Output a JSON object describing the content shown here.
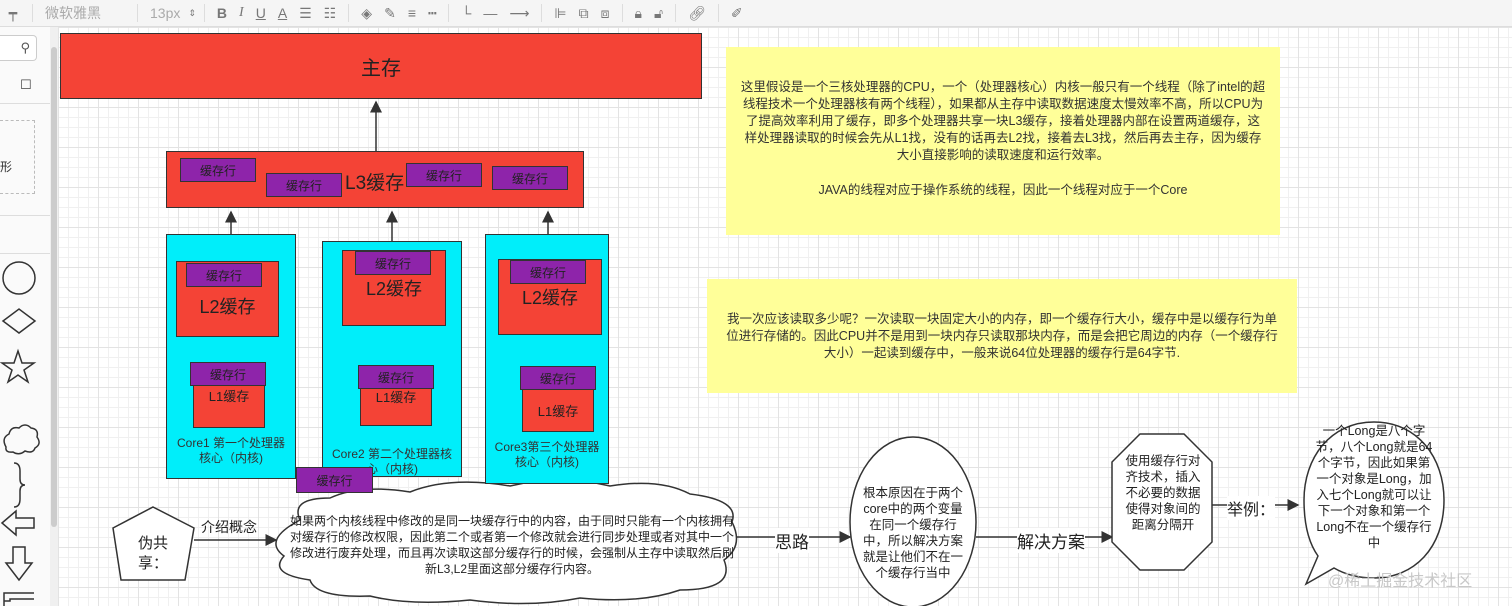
{
  "toolbar": {
    "font_name": "微软雅黑",
    "font_size": "13px",
    "bold": "B",
    "italic": "I",
    "underline": "U",
    "font_color": "A"
  },
  "diagram": {
    "main_memory": "主存",
    "l3_cache": "L3缓存",
    "cache_line": "缓存行",
    "l2_cache": "L2缓存",
    "l1_cache": "L1缓存",
    "core1_label": "Core1 第一个处理器核心（内核)",
    "core2_label": "Core2 第二个处理器核心（内核)",
    "core3_label": "Core3第三个处理器核心（内核)",
    "note1_p1": "这里假设是一个三核处理器的CPU，一个（处理器核心）内核一般只有一个线程（除了intel的超线程技术一个处理器核有两个线程），如果都从主存中读取数据速度太慢效率不高，所以CPU为了提高效率利用了缓存，即多个处理器共享一块L3缓存，接着处理器内部在设置两道缓存，这样处理器读取的时候会先从L1找，没有的话再去L2找，接着去L3找，然后再去主存，因为缓存大小直接影响的读取速度和运行效率。",
    "note1_p2": "JAVA的线程对应于操作系统的线程，因此一个线程对应于一个Core",
    "note2": "我一次应该读取多少呢？一次读取一块固定大小的内存，即一个缓存行大小，缓存中是以缓存行为单位进行存储的。因此CPU并不是用到一块内存只读取那块内存，而是会把它周边的内存（一个缓存行大小）一起读到缓存中，一般来说64位处理器的缓存行是64字节.",
    "false_sharing": "伪共享：",
    "intro_label": "介绍概念",
    "cloud_text": "如果两个内核线程中修改的是同一块缓存行中的内容，由于同时只能有一个内核拥有对缓存行的修改权限，因此第二个或者第一个修改就会进行同步处理或者对其中一个修改进行废弃处理，而且再次读取这部分缓存行的时候，会强制从主存中读取然后刷新L3,L2里面这部分缓存行内容。",
    "idea_label": "思路",
    "ellipse_text": "根本原因在于两个core中的两个变量在同一个缓存行中，所以解决方案就是让他们不在一个缓存行当中",
    "solution_label": "解决方案",
    "octagon_text": "使用缓存行对齐技术，插入不必要的数据使得对象间的距离分隔开",
    "example_label": "举例：",
    "bubble_text": "一个Long是八个字节，八个Long就是64个字节，因此如果第一个对象是Long，加入七个Long就可以让下一个对象和第一个Long不在一个缓存行中",
    "watermark": "@稀土掘金技术社区"
  },
  "colors": {
    "red": "#f44336",
    "cyan": "#00eefa",
    "purple": "#8e24aa",
    "note": "#ffff99"
  }
}
